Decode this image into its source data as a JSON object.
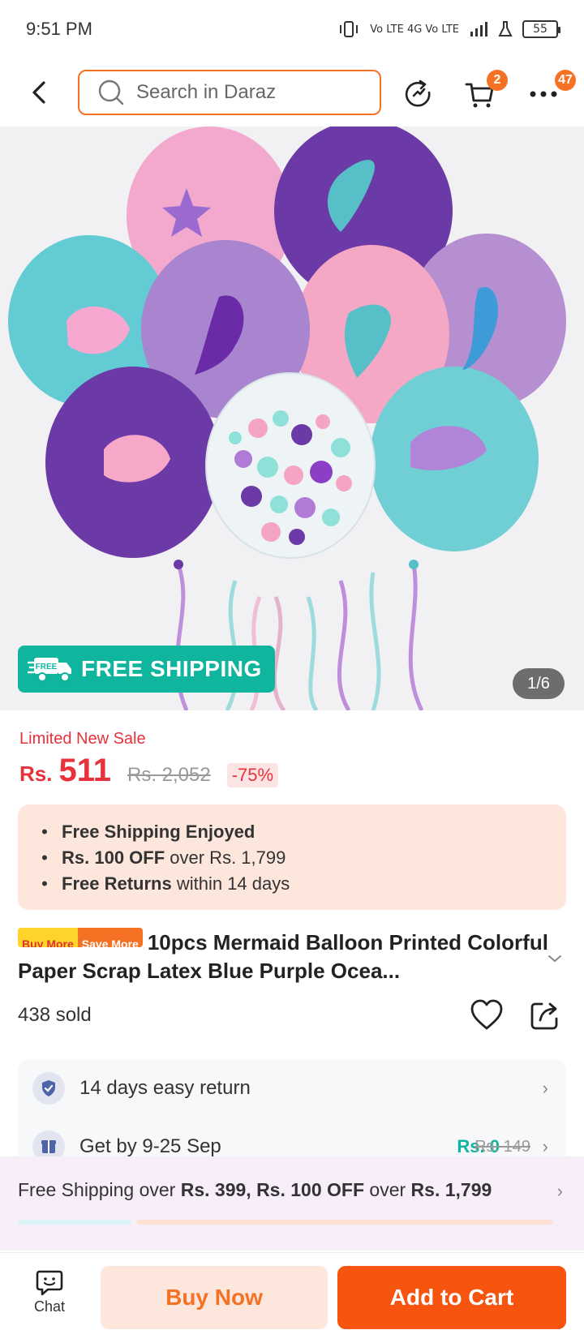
{
  "status_bar": {
    "time": "9:51 PM",
    "network": "Vo LTE 4G Vo LTE",
    "battery": "55"
  },
  "header": {
    "search_placeholder": "Search in Daraz",
    "cart_badge": "2",
    "more_badge": "47"
  },
  "hero": {
    "free_shipping_tag": "FREE",
    "free_shipping_label": "FREE SHIPPING",
    "image_counter": "1/6"
  },
  "pricing": {
    "sale_label": "Limited New Sale",
    "currency": "Rs.",
    "price": "511",
    "original_price": "Rs. 2,052",
    "discount": "-75%"
  },
  "promo": {
    "items": [
      {
        "bold": "Free Shipping Enjoyed",
        "rest": ""
      },
      {
        "bold": "Rs. 100 OFF",
        "rest": " over Rs. 1,799"
      },
      {
        "bold": "Free Returns",
        "rest": " within 14 days"
      }
    ]
  },
  "product": {
    "tag_a": "Buy More",
    "tag_b": "Save More",
    "title": "10pcs Mermaid Balloon Printed Colorful Paper Scrap Latex Blue Purple Ocea...",
    "sold": "438 sold"
  },
  "info": {
    "return_text": "14 days easy return",
    "delivery_text": "Get by 9-25 Sep",
    "delivery_fee": "Rs. 0",
    "delivery_old_fee": "Rs. 149"
  },
  "shipping_banner": {
    "p1": "Free Shipping over ",
    "b1": "Rs. 399, Rs. 100 OFF",
    "p2": " over ",
    "b2": "Rs. 1,799"
  },
  "bottom_bar": {
    "chat_label": "Chat",
    "buy_now": "Buy Now",
    "add_to_cart": "Add to Cart"
  },
  "colors": {
    "brand_orange": "#f57224",
    "price_red": "#e7323c",
    "free_ship_teal": "#0fb59c"
  }
}
